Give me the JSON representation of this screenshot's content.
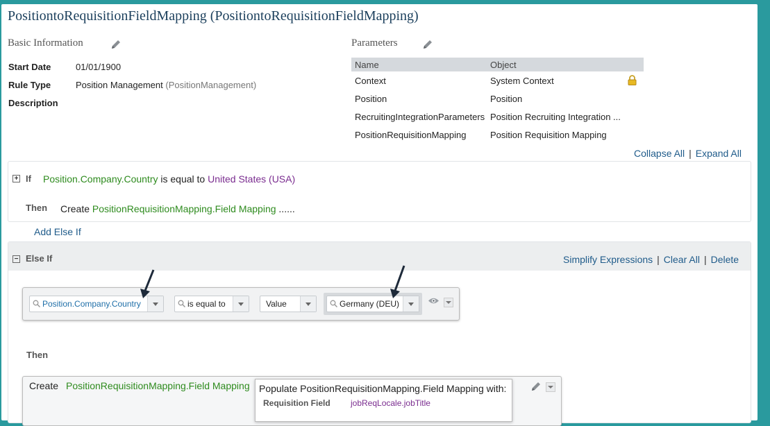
{
  "header": {
    "title": "PositiontoRequisitionFieldMapping (PositiontoRequisitionFieldMapping)"
  },
  "basic_info": {
    "section_title": "Basic Information",
    "fields": [
      {
        "label": "Start Date",
        "value": "01/01/1900",
        "extra": ""
      },
      {
        "label": "Rule Type",
        "value": "Position Management",
        "extra": "(PositionManagement)"
      },
      {
        "label": "Description",
        "value": "",
        "extra": ""
      }
    ]
  },
  "parameters": {
    "section_title": "Parameters",
    "columns": [
      "Name",
      "Object"
    ],
    "rows": [
      {
        "name": "Context",
        "object": "System Context",
        "locked": true
      },
      {
        "name": "Position",
        "object": "Position",
        "locked": false
      },
      {
        "name": "RecruitingIntegrationParameters",
        "object": "Position Recruiting Integration ...",
        "locked": false
      },
      {
        "name": "PositionRequisitionMapping",
        "object": "Position Requisition Mapping",
        "locked": false
      }
    ]
  },
  "actions": {
    "collapse_all": "Collapse All",
    "expand_all": "Expand All"
  },
  "if_block": {
    "keyword": "If",
    "field": "Position.Company.Country",
    "operator": "is equal to",
    "value": "United States (USA)",
    "then_keyword": "Then",
    "then_action": "Create",
    "then_target": "PositionRequisitionMapping.Field Mapping",
    "then_more": "......",
    "add_else_if": "Add Else If"
  },
  "else_if_block": {
    "keyword": "Else If",
    "simplify": "Simplify Expressions",
    "clear_all": "Clear All",
    "delete": "Delete",
    "condition": {
      "field": "Position.Company.Country",
      "operator": "is equal to",
      "value_type": "Value",
      "value": "Germany (DEU)"
    },
    "then_keyword": "Then",
    "create_label": "Create",
    "create_target": "PositionRequisitionMapping.Field Mapping",
    "populate": {
      "title": "Populate PositionRequisitionMapping.Field Mapping with:",
      "field_label": "Requisition Field",
      "field_value": "jobReqLocale.jobTitle"
    }
  },
  "colors": {
    "background_teal": "#2a9a9e",
    "title_blue": "#1b3f5c",
    "link_blue": "#1f5b8a",
    "field_green": "#2e8b1e",
    "value_purple": "#7a2c8f"
  }
}
